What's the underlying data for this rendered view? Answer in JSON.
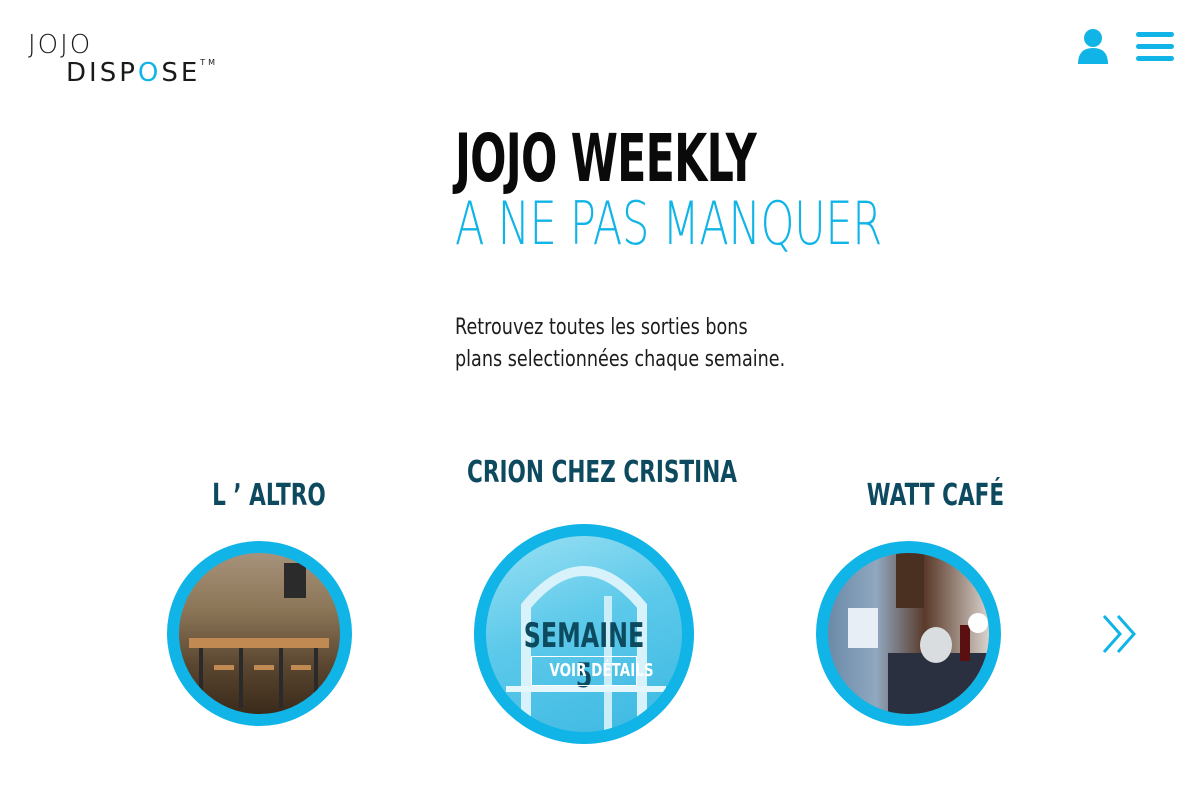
{
  "header": {
    "logo": {
      "top": "JOJO",
      "bottom": "DISP",
      "pin": "O",
      "bottom_end": "SE",
      "tm": "TM"
    },
    "icons": {
      "user": "user-icon",
      "menu": "hamburger-menu-icon"
    }
  },
  "hero": {
    "title": "JOJO WEEKLY",
    "subtitle": "A NE PAS MANQUER",
    "intro": "Retrouvez toutes les sorties bons plans selectionnées chaque semaine."
  },
  "carousel": {
    "items": [
      {
        "title": "L ’ ALTRO"
      },
      {
        "title": "CRION CHEZ CRISTINA",
        "overlay_title": "SEMAINE 5",
        "details_label": "VOIR DÉTAILS"
      },
      {
        "title": "WATT CAFÉ"
      }
    ],
    "next_icon": "double-chevron-right-icon"
  },
  "colors": {
    "accent": "#10b4e6",
    "title_dark": "#0d4a5f",
    "text": "#1c1c1c"
  }
}
